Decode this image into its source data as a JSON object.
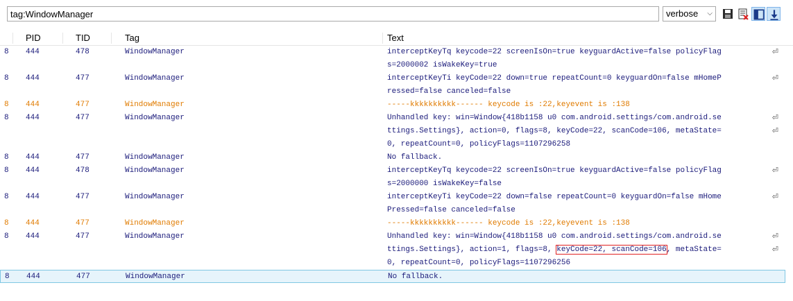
{
  "toolbar": {
    "filter_value": "tag:WindowManager",
    "level_value": "verbose",
    "level_chevron": "⌵",
    "icons": [
      "save-icon",
      "clear-log-icon",
      "toggle-columns-icon",
      "scroll-lock-icon"
    ]
  },
  "columns": {
    "level": "",
    "pid": "PID",
    "tid": "TID",
    "tag": "Tag",
    "text": "Text"
  },
  "wrap_glyph": "⏎",
  "rows": [
    {
      "lv": "8",
      "pid": "444",
      "tid": "478",
      "tag": "WindowManager",
      "lines": [
        "interceptKeyTq keycode=22 screenIsOn=true keyguardActive=false policyFlag",
        "s=2000002 isWakeKey=true"
      ]
    },
    {
      "lv": "8",
      "pid": "444",
      "tid": "477",
      "tag": "WindowManager",
      "lines": [
        "interceptKeyTi keyCode=22 down=true repeatCount=0 keyguardOn=false mHomeP",
        "ressed=false canceled=false"
      ]
    },
    {
      "lv": "8",
      "pid": "444",
      "tid": "477",
      "tag": "WindowManager",
      "lines": [
        "-----kkkkkkkkkk------ keycode is :22,keyevent is :138"
      ]
    },
    {
      "lv": "8",
      "pid": "444",
      "tid": "477",
      "tag": "WindowManager",
      "lines": [
        "Unhandled key: win=Window{418b1158 u0 com.android.settings/com.android.se",
        "ttings.Settings}, action=0, flags=8, keyCode=22, scanCode=106, metaState=",
        "0, repeatCount=0, policyFlags=1107296258"
      ]
    },
    {
      "lv": "8",
      "pid": "444",
      "tid": "477",
      "tag": "WindowManager",
      "lines": [
        "No fallback."
      ]
    },
    {
      "lv": "8",
      "pid": "444",
      "tid": "478",
      "tag": "WindowManager",
      "lines": [
        "interceptKeyTq keycode=22 screenIsOn=true keyguardActive=false policyFlag",
        "s=2000000 isWakeKey=false"
      ]
    },
    {
      "lv": "8",
      "pid": "444",
      "tid": "477",
      "tag": "WindowManager",
      "lines": [
        "interceptKeyTi keyCode=22 down=false repeatCount=0 keyguardOn=false mHome",
        "Pressed=false canceled=false"
      ]
    },
    {
      "lv": "8",
      "pid": "444",
      "tid": "477",
      "tag": "WindowManager",
      "lines": [
        "-----kkkkkkkkkk------ keycode is :22,keyevent is :138"
      ]
    },
    {
      "lv": "8",
      "pid": "444",
      "tid": "477",
      "tag": "WindowManager",
      "lines": [
        "Unhandled key: win=Window{418b1158 u0 com.android.settings/com.android.se",
        "ttings.Settings}, action=1, flags=8, ",
        "0, repeatCount=0, policyFlags=1107296256"
      ],
      "hl_prefix": "ttings.Settings}, action=1, flags=8, ",
      "hl_text": "keyCode=22, scanCode=106",
      "hl_suffix": " metaState="
    },
    {
      "lv": "8",
      "pid": "444",
      "tid": "477",
      "tag": "WindowManager",
      "lines": [
        "No fallback."
      ]
    }
  ],
  "colors": {
    "info": "#1a1a7a",
    "warn": "#e07b00",
    "selected_bg": "#e6f4fb",
    "highlight_border": "#e02020"
  }
}
